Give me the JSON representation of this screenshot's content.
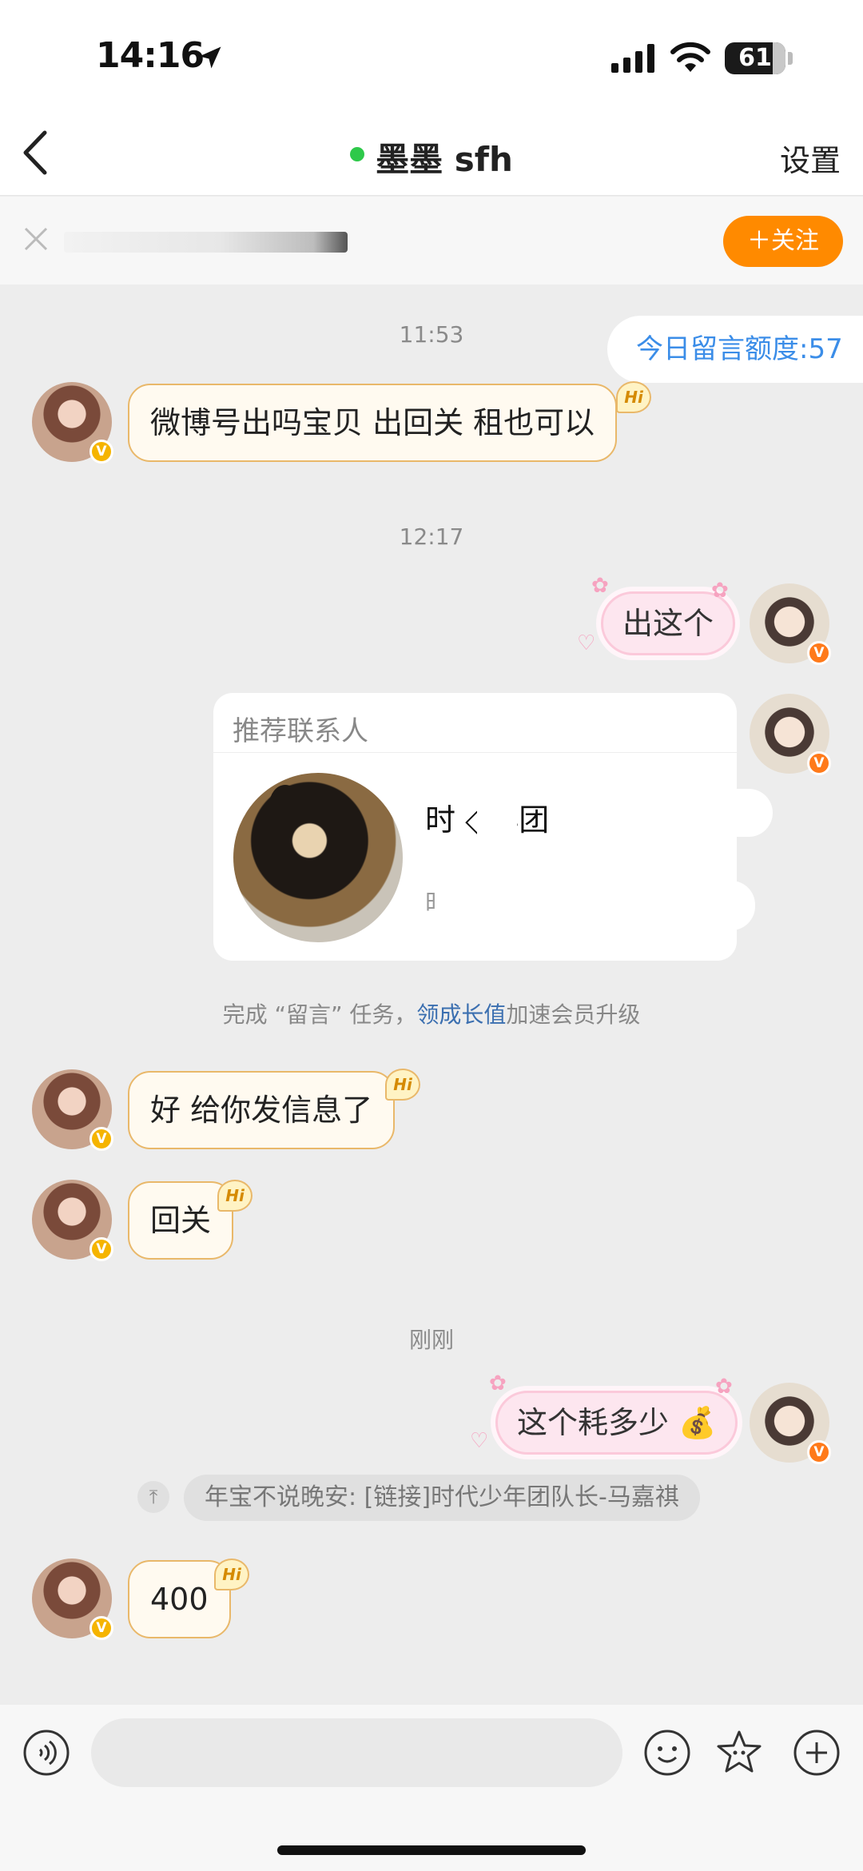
{
  "status_bar": {
    "time": "14:16",
    "battery": "61"
  },
  "header": {
    "title": "墨墨 sfh",
    "settings": "设置"
  },
  "follow_bar": {
    "follow_label": "＋关注"
  },
  "quota": "今日留言额度:57",
  "timestamps": [
    "11:53",
    "12:17",
    "刚刚"
  ],
  "messages": {
    "m1": "微博号出吗宝贝 出回关 租也可以",
    "m2": "出这个",
    "m3": "好 给你发信息了",
    "m4": "回关",
    "m5": "这个耗多少 💰",
    "m6": "400"
  },
  "card": {
    "title": "推荐联系人",
    "name": "时   ◇年团",
    "sub": "时"
  },
  "task": {
    "prefix": "完成 “留言” 任务，",
    "link": "领成长值",
    "suffix": "加速会员升级"
  },
  "quote": "年宝不说晚安: [链接]时代少年团队长-马嘉祺",
  "hi_badge": "Hi",
  "verified_mark": "V",
  "input": {
    "placeholder": ""
  },
  "colors": {
    "accent": "#ff8a00",
    "link": "#3b8de8",
    "online": "#2ec94a"
  }
}
